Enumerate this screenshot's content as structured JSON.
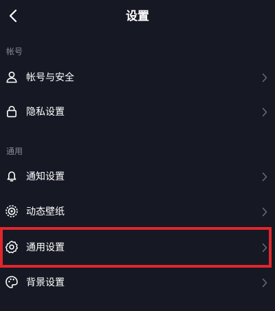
{
  "header": {
    "title": "设置",
    "back_icon": "chevron-left-icon"
  },
  "sections": [
    {
      "label": "帐号",
      "items": [
        {
          "label": "帐号与安全",
          "icon": "user-icon"
        },
        {
          "label": "隐私设置",
          "icon": "lock-icon"
        }
      ]
    },
    {
      "label": "通用",
      "items": [
        {
          "label": "通知设置",
          "icon": "bell-icon"
        },
        {
          "label": "动态壁纸",
          "icon": "live-wallpaper-icon"
        },
        {
          "label": "通用设置",
          "icon": "gear-icon",
          "highlighted": true
        },
        {
          "label": "背景设置",
          "icon": "palette-icon"
        }
      ]
    }
  ],
  "colors": {
    "background": "#161823",
    "text": "#ffffff",
    "section_label": "#8a8b91",
    "chevron": "#6c6d73",
    "highlight": "#e0262d"
  }
}
